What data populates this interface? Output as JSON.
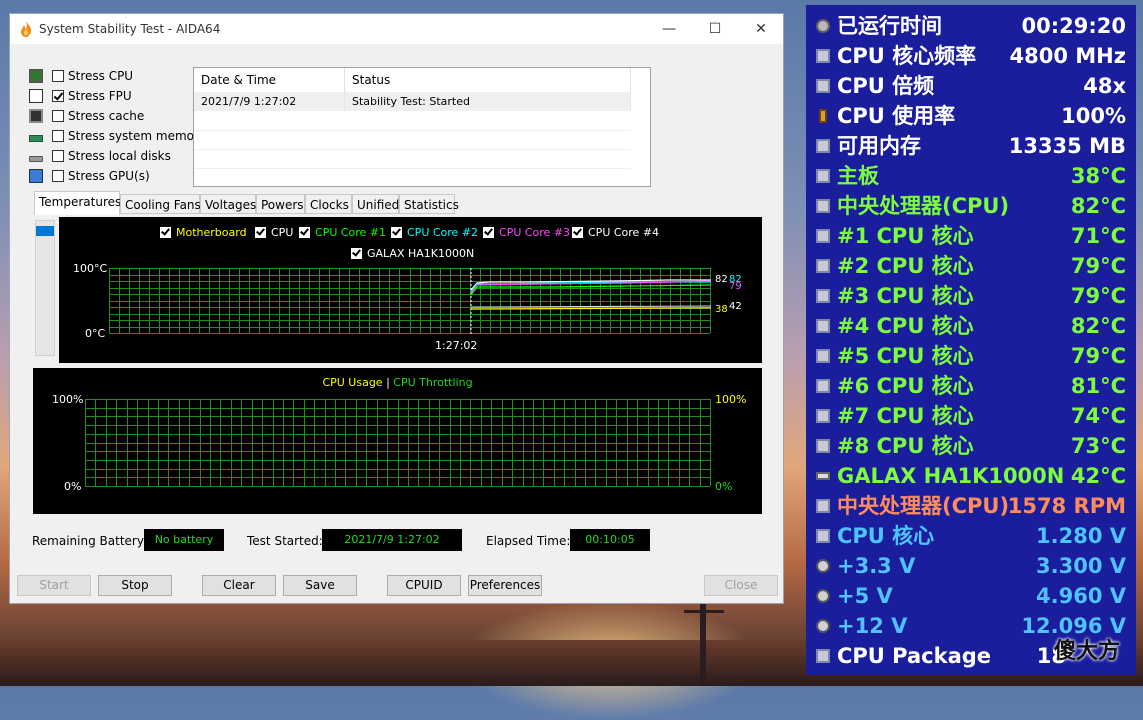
{
  "window": {
    "title": "System Stability Test - AIDA64",
    "minimize_icon": "—",
    "maximize_icon": "☐",
    "close_icon": "✕"
  },
  "stress_options": [
    {
      "label": "Stress CPU",
      "checked": false,
      "icon": "cpu-chip-icon"
    },
    {
      "label": "Stress FPU",
      "checked": true,
      "icon": "fpu-icon"
    },
    {
      "label": "Stress cache",
      "checked": false,
      "icon": "cache-icon"
    },
    {
      "label": "Stress system memory",
      "checked": false,
      "icon": "memory-icon"
    },
    {
      "label": "Stress local disks",
      "checked": false,
      "icon": "disk-icon"
    },
    {
      "label": "Stress GPU(s)",
      "checked": false,
      "icon": "gpu-icon"
    }
  ],
  "log": {
    "headers": [
      "Date & Time",
      "Status"
    ],
    "rows": [
      {
        "datetime": "2021/7/9 1:27:02",
        "status": "Stability Test: Started"
      }
    ]
  },
  "tabs": [
    "Temperatures",
    "Cooling Fans",
    "Voltages",
    "Powers",
    "Clocks",
    "Unified",
    "Statistics"
  ],
  "active_tab": "Temperatures",
  "temp_chart": {
    "legend": [
      {
        "label": "Motherboard",
        "color": "#ffff00"
      },
      {
        "label": "CPU",
        "color": "#ffffff"
      },
      {
        "label": "CPU Core #1",
        "color": "#00ff00"
      },
      {
        "label": "CPU Core #2",
        "color": "#00ffff"
      },
      {
        "label": "CPU Core #3",
        "color": "#ff44ff"
      },
      {
        "label": "CPU Core #4",
        "color": "#ffffff"
      },
      {
        "label": "GALAX HA1K1000N",
        "color": "#ffffff"
      }
    ],
    "y_top": "100°C",
    "y_bottom": "0°C",
    "x_marker": "1:27:02",
    "end_labels": {
      "top_a": "82",
      "top_b": "82",
      "mid": "79",
      "low_a": "38",
      "low_b": "42"
    }
  },
  "usage_chart": {
    "title_a": "CPU Usage",
    "separator": "|",
    "title_b": "CPU Throttling",
    "left_top": "100%",
    "left_bottom": "0%",
    "right_top": "100%",
    "right_bottom": "0%"
  },
  "status": {
    "battery_label": "Remaining Battery:",
    "battery_value": "No battery",
    "started_label": "Test Started:",
    "started_value": "2021/7/9 1:27:02",
    "elapsed_label": "Elapsed Time:",
    "elapsed_value": "00:10:05"
  },
  "buttons": {
    "start": "Start",
    "stop": "Stop",
    "clear": "Clear",
    "save": "Save",
    "cpuid": "CPUID",
    "preferences": "Preferences",
    "close": "Close"
  },
  "osd": [
    {
      "label": "已运行时间",
      "value": "00:29:20",
      "color": "#ffffff",
      "vcolor": "#ffffff",
      "icon": "clock-icon"
    },
    {
      "label": "CPU 核心频率",
      "value": "4800 MHz",
      "color": "#ffffff",
      "vcolor": "#ffffff",
      "icon": "cpu-icon"
    },
    {
      "label": "CPU 倍频",
      "value": "48x",
      "color": "#ffffff",
      "vcolor": "#ffffff",
      "icon": "cpu-icon"
    },
    {
      "label": "CPU 使用率",
      "value": "100%",
      "color": "#ffffff",
      "vcolor": "#ffffff",
      "icon": "hourglass-icon"
    },
    {
      "label": "可用内存",
      "value": "13335 MB",
      "color": "#ffffff",
      "vcolor": "#ffffff",
      "icon": "memory-icon"
    },
    {
      "label": "主板",
      "value": "38°C",
      "color": "#7cfc3c",
      "vcolor": "#7cfc3c",
      "icon": "motherboard-icon"
    },
    {
      "label": "中央处理器(CPU)",
      "value": "82°C",
      "color": "#7cfc3c",
      "vcolor": "#7cfc3c",
      "icon": "cpu-icon"
    },
    {
      "label": "#1 CPU 核心",
      "value": "71°C",
      "color": "#7cfc3c",
      "vcolor": "#7cfc3c",
      "icon": "cpu-icon"
    },
    {
      "label": "#2 CPU 核心",
      "value": "79°C",
      "color": "#7cfc3c",
      "vcolor": "#7cfc3c",
      "icon": "cpu-icon"
    },
    {
      "label": "#3 CPU 核心",
      "value": "79°C",
      "color": "#7cfc3c",
      "vcolor": "#7cfc3c",
      "icon": "cpu-icon"
    },
    {
      "label": "#4 CPU 核心",
      "value": "82°C",
      "color": "#7cfc3c",
      "vcolor": "#7cfc3c",
      "icon": "cpu-icon"
    },
    {
      "label": "#5 CPU 核心",
      "value": "79°C",
      "color": "#7cfc3c",
      "vcolor": "#7cfc3c",
      "icon": "cpu-icon"
    },
    {
      "label": "#6 CPU 核心",
      "value": "81°C",
      "color": "#7cfc3c",
      "vcolor": "#7cfc3c",
      "icon": "cpu-icon"
    },
    {
      "label": "#7 CPU 核心",
      "value": "74°C",
      "color": "#7cfc3c",
      "vcolor": "#7cfc3c",
      "icon": "cpu-icon"
    },
    {
      "label": "#8 CPU 核心",
      "value": "73°C",
      "color": "#7cfc3c",
      "vcolor": "#7cfc3c",
      "icon": "cpu-icon"
    },
    {
      "label": "GALAX HA1K1000N",
      "value": "42°C",
      "color": "#7cfc3c",
      "vcolor": "#7cfc3c",
      "icon": "drive-icon"
    },
    {
      "label": "中央处理器(CPU)",
      "value": "1578 RPM",
      "color": "#ff8c5a",
      "vcolor": "#ff8c5a",
      "icon": "cpu-icon"
    },
    {
      "label": "CPU 核心",
      "value": "1.280 V",
      "color": "#4fc3ff",
      "vcolor": "#4fc3ff",
      "icon": "cpu-icon"
    },
    {
      "label": "+3.3 V",
      "value": "3.300 V",
      "color": "#4fc3ff",
      "vcolor": "#4fc3ff",
      "icon": "voltage-icon"
    },
    {
      "label": "+5 V",
      "value": "4.960 V",
      "color": "#4fc3ff",
      "vcolor": "#4fc3ff",
      "icon": "voltage-icon"
    },
    {
      "label": "+12 V",
      "value": "12.096 V",
      "color": "#4fc3ff",
      "vcolor": "#4fc3ff",
      "icon": "voltage-icon"
    },
    {
      "label": "CPU Package",
      "value": "18",
      "color": "#ffffff",
      "vcolor": "#ffffff",
      "icon": "cpu-icon"
    }
  ],
  "watermark": "傻大方"
}
